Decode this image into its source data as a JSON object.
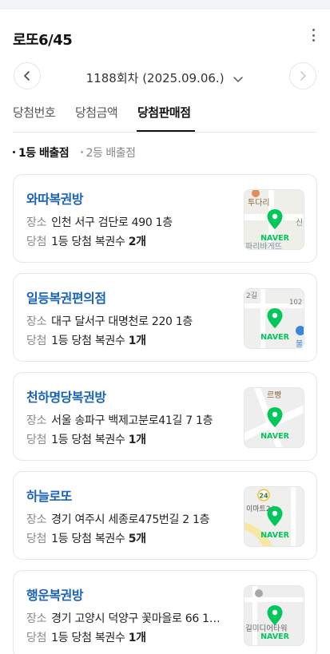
{
  "header": {
    "title": "로또6/45"
  },
  "round": {
    "label": "1188회차 (2025.09.06.)"
  },
  "tabs": [
    {
      "label": "당첨번호"
    },
    {
      "label": "당첨금액"
    },
    {
      "label": "당첨판매점",
      "active": true
    }
  ],
  "filters": [
    {
      "label": "1등 배출점",
      "active": true
    },
    {
      "label": "2등 배출점",
      "active": false
    }
  ],
  "labels": {
    "address": "장소",
    "win": "당첨"
  },
  "map_brand": "NAVER",
  "stores": [
    {
      "name": "와따복권방",
      "address": "인천 서구 검단로 490 1층",
      "win_prefix": "1등 당첨 복권수",
      "win_count": "2개",
      "map_labels": [
        "투다리",
        "신",
        "파리바게뜨"
      ]
    },
    {
      "name": "일등복권편의점",
      "address": "대구 달서구 대명천로 220 1층",
      "win_prefix": "1등 당첨 복권수",
      "win_count": "1개",
      "map_labels": [
        "2길",
        "102",
        "불"
      ]
    },
    {
      "name": "천하명당복권방",
      "address": "서울 송파구 백제고분로41길 7 1층",
      "win_prefix": "1등 당첨 복권수",
      "win_count": "1개",
      "map_labels": [
        "르빵"
      ]
    },
    {
      "name": "하늘로또",
      "address": "경기 여주시 세종로475번길 2 1층",
      "win_prefix": "1등 당첨 복권수",
      "win_count": "5개",
      "map_labels": [
        "24",
        "이마트24"
      ]
    },
    {
      "name": "행운복권방",
      "address": "경기 고양시 덕양구 꽃마을로 66 1…",
      "win_prefix": "1등 당첨 복권수",
      "win_count": "1개",
      "map_labels": [
        "길미디어타워"
      ]
    }
  ],
  "colors": {
    "store_name": "#1a63b8",
    "naver_green": "#03c75a",
    "tab_active": "#111111"
  }
}
